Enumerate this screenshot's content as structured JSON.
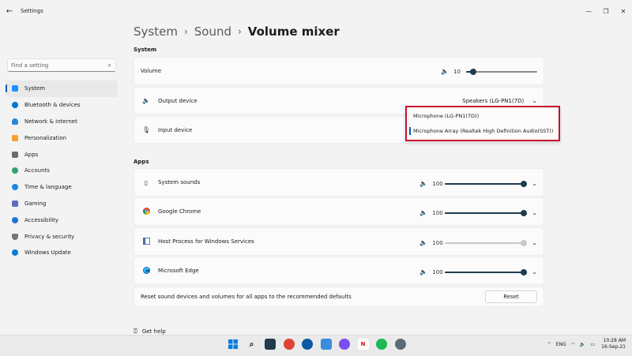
{
  "window": {
    "title": "Settings",
    "back": "←",
    "min": "—",
    "max": "❐",
    "close": "✕"
  },
  "search": {
    "placeholder": "Find a setting"
  },
  "nav": [
    {
      "label": "System",
      "color": "#1e90ff",
      "active": true
    },
    {
      "label": "Bluetooth & devices",
      "color": "#0078d4"
    },
    {
      "label": "Network & internet",
      "color": "#2b88d8"
    },
    {
      "label": "Personalization",
      "color": "#f7a12b"
    },
    {
      "label": "Apps",
      "color": "#6b6b6b"
    },
    {
      "label": "Accounts",
      "color": "#2fa36b"
    },
    {
      "label": "Time & language",
      "color": "#1e88e5"
    },
    {
      "label": "Gaming",
      "color": "#5c6bc0"
    },
    {
      "label": "Accessibility",
      "color": "#1976d2"
    },
    {
      "label": "Privacy & security",
      "color": "#757575"
    },
    {
      "label": "Windows Update",
      "color": "#0a7cd9"
    }
  ],
  "breadcrumb": {
    "part1": "System",
    "part2": "Sound",
    "current": "Volume mixer",
    "sep": "›"
  },
  "system": {
    "heading": "System",
    "volume_label": "Volume",
    "volume_value": "10",
    "volume_fraction": 0.1,
    "output_label": "Output device",
    "output_value": "Speakers (LG-PN1(7D)",
    "input_label": "Input device"
  },
  "dropdown": {
    "items": [
      "Microphone (LG-PN1(7D))",
      "Microphone Array (Realtek High Definition Audio(SST))"
    ]
  },
  "apps": {
    "heading": "Apps",
    "items": [
      {
        "name": "System sounds",
        "value": "100",
        "fraction": 1.0,
        "disabled": false
      },
      {
        "name": "Google Chrome",
        "value": "100",
        "fraction": 1.0,
        "disabled": false
      },
      {
        "name": "Host Process for Windows Services",
        "value": "100",
        "fraction": 1.0,
        "disabled": true
      },
      {
        "name": "Microsoft Edge",
        "value": "100",
        "fraction": 1.0,
        "disabled": false
      }
    ]
  },
  "reset": {
    "text": "Reset sound devices and volumes for all apps to the recommended defaults",
    "button": "Reset"
  },
  "help": {
    "label": "Get help"
  },
  "tray": {
    "lang": "ENG",
    "time": "10:28 AM",
    "date": "16-Sep-21"
  }
}
